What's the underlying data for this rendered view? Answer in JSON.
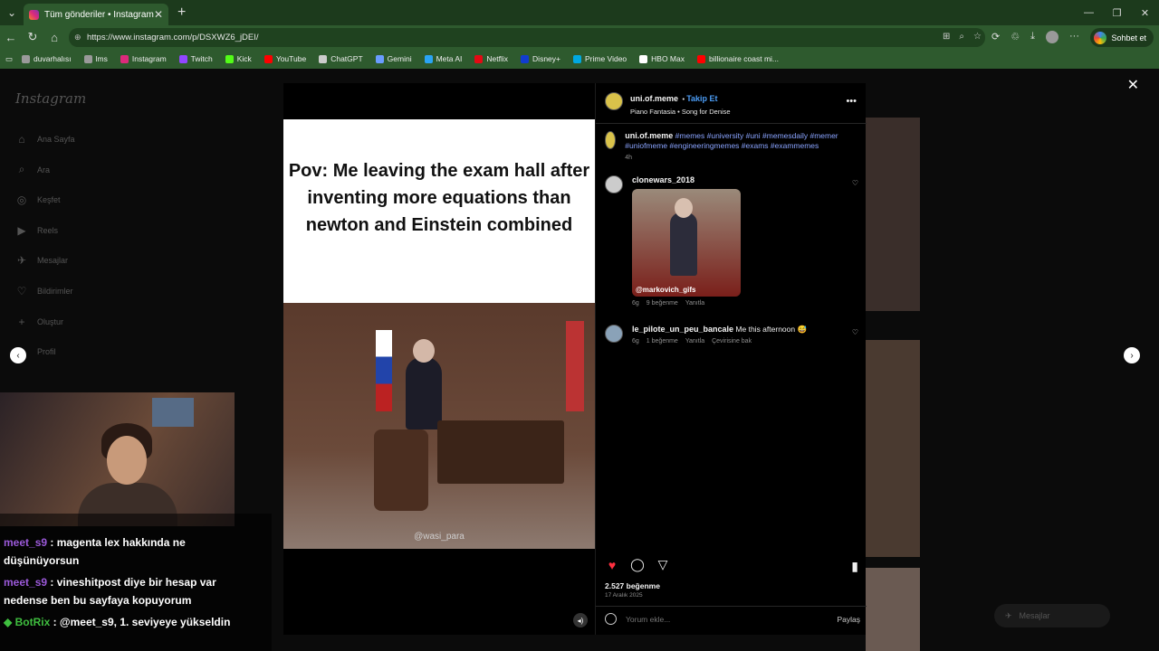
{
  "browser": {
    "tab_title": "Tüm gönderiler • Instagram",
    "url": "https://www.instagram.com/p/DSXWZ6_jDEI/",
    "copilot_label": "Sohbet et",
    "bookmarks": [
      {
        "label": "duvarhalısı",
        "color": "#9a9a9a"
      },
      {
        "label": "lms",
        "color": "#9a9a9a"
      },
      {
        "label": "Instagram",
        "color": "#dd2a7b"
      },
      {
        "label": "Twitch",
        "color": "#9146ff"
      },
      {
        "label": "Kick",
        "color": "#53fc18"
      },
      {
        "label": "YouTube",
        "color": "#ff0000"
      },
      {
        "label": "ChatGPT",
        "color": "#cccccc"
      },
      {
        "label": "Gemini",
        "color": "#6a9cff"
      },
      {
        "label": "Meta AI",
        "color": "#2aa4f4"
      },
      {
        "label": "Netflix",
        "color": "#e50914"
      },
      {
        "label": "Disney+",
        "color": "#113ccf"
      },
      {
        "label": "Prime Video",
        "color": "#00a8e1"
      },
      {
        "label": "HBO Max",
        "color": "#ffffff"
      },
      {
        "label": "billionaire coast mi...",
        "color": "#ff0000"
      }
    ]
  },
  "sidebar": {
    "logo": "Instagram",
    "items": [
      {
        "label": "Ana Sayfa",
        "icon": "⌂"
      },
      {
        "label": "Ara",
        "icon": "⌕"
      },
      {
        "label": "Keşfet",
        "icon": "◎"
      },
      {
        "label": "Reels",
        "icon": "▶"
      },
      {
        "label": "Mesajlar",
        "icon": "✈"
      },
      {
        "label": "Bildirimler",
        "icon": "♡"
      },
      {
        "label": "Oluştur",
        "icon": "+"
      },
      {
        "label": "Profil",
        "icon": "●"
      }
    ]
  },
  "post": {
    "caption_image_text": "Pov: Me leaving the exam hall after inventing more equations than newton and Einstein combined",
    "watermark": "@wasi_para",
    "author": "uni.of.meme",
    "follow_label": "Takip Et",
    "song": "Piano Fantasia • Song for Denise",
    "description_tags": "#memes #university #uni #memesdaily #memer #uniofmeme #engineeringmemes #exams #exammemes",
    "description_time": "4h",
    "likes": "2.527 beğenme",
    "date": "17 Aralık 2025",
    "comment_placeholder": "Yorum ekle...",
    "share_label": "Paylaş"
  },
  "comments": [
    {
      "user": "clonewars_2018",
      "text": "",
      "gif_tag": "@markovich_gifs",
      "time": "6g",
      "likes": "9 beğenme",
      "reply": "Yanıtla"
    },
    {
      "user": "le_pilote_un_peu_bancale",
      "text": "Me this afternoon 😅",
      "time": "6g",
      "likes": "1 beğenme",
      "reply": "Yanıtla",
      "translate": "Çevirisine bak"
    }
  ],
  "floating": {
    "messages_label": "Mesajlar"
  },
  "chat": [
    {
      "user": "meet_s9",
      "text": "magenta lex hakkında ne düşünüyorsun"
    },
    {
      "user": "meet_s9",
      "text": "vineshitpost diye bir hesap var nedense ben bu sayfaya kopuyorum"
    },
    {
      "user": "BotRix",
      "text": "@meet_s9, 1. seviyeye yükseldin"
    }
  ]
}
